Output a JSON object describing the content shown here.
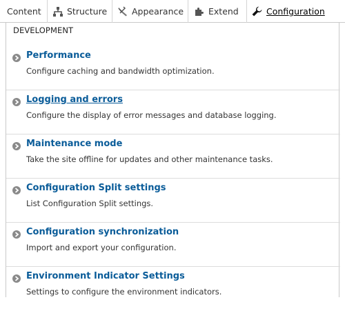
{
  "toolbar": {
    "tabs": [
      {
        "label": "Content",
        "icon": "none"
      },
      {
        "label": "Structure",
        "icon": "structure-icon"
      },
      {
        "label": "Appearance",
        "icon": "paintbrush-icon"
      },
      {
        "label": "Extend",
        "icon": "puzzle-icon"
      },
      {
        "label": "Configuration",
        "icon": "wrench-icon"
      }
    ]
  },
  "section": {
    "title": "DEVELOPMENT"
  },
  "items": [
    {
      "title": "Performance",
      "description": "Configure caching and bandwidth optimization."
    },
    {
      "title": "Logging and errors",
      "description": "Configure the display of error messages and database logging."
    },
    {
      "title": "Maintenance mode",
      "description": "Take the site offline for updates and other maintenance tasks."
    },
    {
      "title": "Configuration Split settings",
      "description": "List Configuration Split settings."
    },
    {
      "title": "Configuration synchronization",
      "description": "Import and export your configuration."
    },
    {
      "title": "Environment Indicator Settings",
      "description": "Settings to configure the environment indicators."
    }
  ],
  "colors": {
    "link": "#0a5c99",
    "bullet": "#8a8a8a"
  }
}
